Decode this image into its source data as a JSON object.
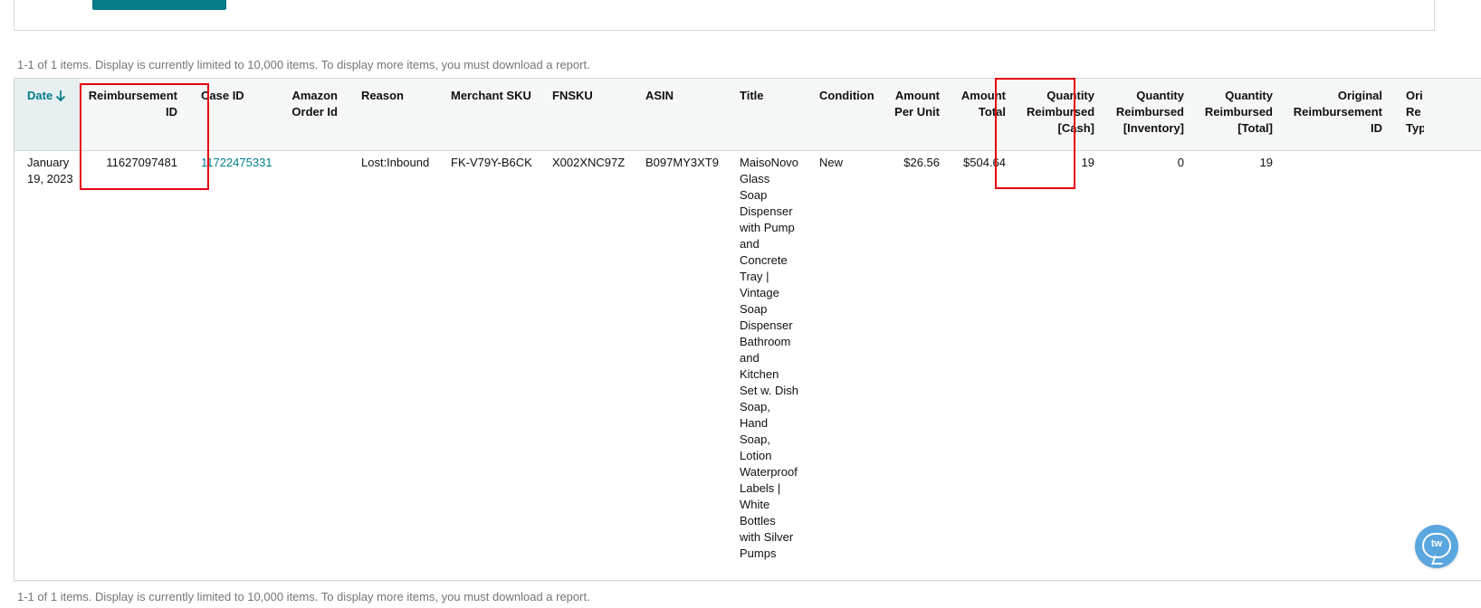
{
  "summary": {
    "text": "1-1 of 1 items. Display is currently limited to 10,000 items. To display more items, you must download a report."
  },
  "table": {
    "columns": [
      {
        "key": "date",
        "label": "Date"
      },
      {
        "key": "reimbursement_id",
        "label": "Reimbursement ID"
      },
      {
        "key": "case_id",
        "label": "Case ID"
      },
      {
        "key": "amazon_order_id",
        "label": "Amazon Order Id"
      },
      {
        "key": "reason",
        "label": "Reason"
      },
      {
        "key": "merchant_sku",
        "label": "Merchant SKU"
      },
      {
        "key": "fnsku",
        "label": "FNSKU"
      },
      {
        "key": "asin",
        "label": "ASIN"
      },
      {
        "key": "title",
        "label": "Title"
      },
      {
        "key": "condition",
        "label": "Condition"
      },
      {
        "key": "amount_per_unit",
        "label": "Amount Per Unit"
      },
      {
        "key": "amount_total",
        "label": "Amount Total"
      },
      {
        "key": "qty_cash",
        "label": "Quantity Reimbursed [Cash]"
      },
      {
        "key": "qty_inventory",
        "label": "Quantity Reimbursed [Inventory]"
      },
      {
        "key": "qty_total",
        "label": "Quantity Reimbursed [Total]"
      },
      {
        "key": "original_reimbursement_id",
        "label": "Original Reimbursement ID"
      },
      {
        "key": "original_reimbursement_type",
        "label": "Ori Re Typ"
      }
    ],
    "sort": {
      "column": "date",
      "direction": "descending",
      "icon": "arrow-down-icon"
    },
    "rows": [
      {
        "date": "January 19, 2023",
        "reimbursement_id": "11627097481",
        "case_id": "11722475331",
        "amazon_order_id": "",
        "reason": "Lost:Inbound",
        "merchant_sku": "FK-V79Y-B6CK",
        "fnsku": "X002XNC97Z",
        "asin": "B097MY3XT9",
        "title": "MaisoNovo Glass Soap Dispenser with Pump and Concrete Tray | Vintage Soap Dispenser Bathroom and Kitchen Set w. Dish Soap, Hand Soap, Lotion Waterproof Labels | White Bottles with Silver Pumps",
        "condition": "New",
        "amount_per_unit": "$26.56",
        "amount_total": "$504.64",
        "qty_cash": "19",
        "qty_inventory": "0",
        "qty_total": "19",
        "original_reimbursement_id": "",
        "original_reimbursement_type": ""
      }
    ]
  },
  "highlighted_columns": [
    "reimbursement_id",
    "amount_total"
  ],
  "colors": {
    "accent": "#017e89",
    "button": "#077b87",
    "highlight": "#e3000f",
    "chat": "#5aa6df"
  },
  "chat_widget": {
    "icon": "chat-bubble-icon",
    "text": "tw"
  }
}
